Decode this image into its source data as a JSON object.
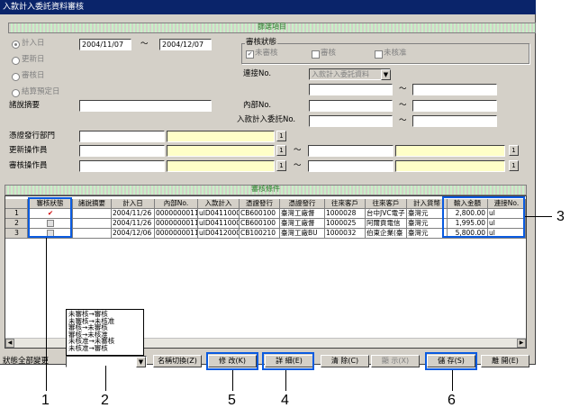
{
  "window": {
    "title": "入款計入委託資料審核"
  },
  "search": {
    "band_title": "篩選項目",
    "radios": [
      "計入日",
      "更新日",
      "審核日",
      "結算預定日"
    ],
    "date_from": "2004/11/07",
    "tilde": "～",
    "date_to": "2004/12/07",
    "summary_label": "摘要",
    "summary_prefix": "諸說",
    "status_group_label": "審核狀態",
    "status_checks": [
      "未審核",
      "審核",
      "未核准"
    ],
    "link_label": "連接No.",
    "link_select": "入款計入委託資料",
    "internal_no_label": "內部No.",
    "trust_no_label": "入款計入委託No.",
    "issue_dept_label": "憑證發行部門",
    "update_op_label": "更新操作員",
    "review_op_label": "審核操作員",
    "lookup_btn": "1"
  },
  "grid": {
    "band_title": "審核條件",
    "columns": [
      "審核狀態",
      "諸說摘要",
      "計入日",
      "內部No.",
      "入款計入",
      "憑證發行",
      "憑證發行",
      "往來客戶",
      "往來客戶",
      "計入貨幣",
      "輸入金額",
      "連接No."
    ],
    "rows": [
      {
        "n": "1",
        "status": "✔",
        "date": "2004/11/26",
        "internal": "0000000011",
        "entry": "ulD0411000",
        "v1": "CB600100",
        "v2": "臺灣工廠督",
        "c1": "1000028",
        "c2": "台中JVC電子",
        "cur": "臺灣元",
        "amt": "2,800.00",
        "link": "ul"
      },
      {
        "n": "2",
        "status": "",
        "date": "2004/11/26",
        "internal": "0000000011",
        "entry": "ulD0411000",
        "v1": "CB600100",
        "v2": "臺灣工廠督",
        "c1": "1000025",
        "c2": "阿爾貢電信",
        "cur": "臺灣元",
        "amt": "1,995.00",
        "link": "ul"
      },
      {
        "n": "3",
        "status": "",
        "date": "2004/12/06",
        "internal": "0000000011",
        "entry": "ulD0412000",
        "v1": "CB100210",
        "v2": "臺灣工廠BU",
        "c1": "1000032",
        "c2": "伯東企業(臺",
        "cur": "臺灣元",
        "amt": "5,800.00",
        "link": "ul"
      }
    ]
  },
  "status_dropdown": {
    "label": "狀態全部變更",
    "options": [
      "未審核→審核",
      "未審核→未核准",
      "審核→未審核",
      "審核→未核准",
      "未核准→未審核",
      "未核准→審核"
    ]
  },
  "buttons": {
    "rename": "名稱切換(Z)",
    "edit": "修 改(K)",
    "detail": "詳 細(E)",
    "clear": "清 除(C)",
    "display": "顯 示(X)",
    "save": "儲 存(S)",
    "close": "離 開(E)"
  },
  "callouts": [
    "1",
    "2",
    "3",
    "4",
    "5",
    "6"
  ],
  "colors": {
    "highlight": "#0a5be0",
    "title_bar": "#0a246a",
    "band": "#c7f0c7",
    "field_yellow": "#ffffc8"
  }
}
